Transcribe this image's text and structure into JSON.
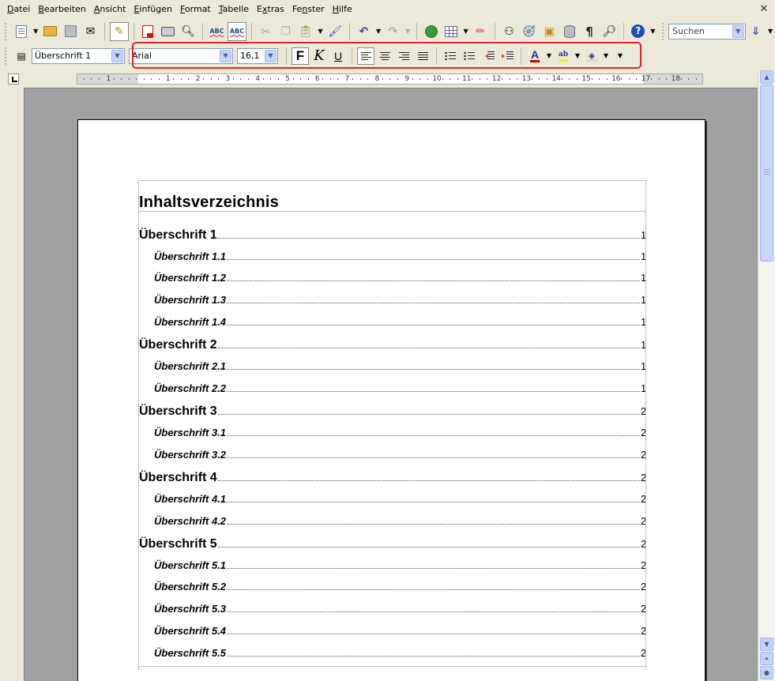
{
  "menu": [
    {
      "label": "Datei",
      "accel": "D"
    },
    {
      "label": "Bearbeiten",
      "accel": "B"
    },
    {
      "label": "Ansicht",
      "accel": "A"
    },
    {
      "label": "Einfügen",
      "accel": "E"
    },
    {
      "label": "Format",
      "accel": "F"
    },
    {
      "label": "Tabelle",
      "accel": "T"
    },
    {
      "label": "Extras",
      "accel": "x"
    },
    {
      "label": "Fenster",
      "accel": "n"
    },
    {
      "label": "Hilfe",
      "accel": "H"
    }
  ],
  "close_glyph": "✕",
  "toolbar": {
    "search_placeholder": "Suchen",
    "paragraph_style": "Überschrift 1",
    "font_name": "Arial",
    "font_size": "16,1",
    "bold_label": "F",
    "italic_label": "K",
    "underline_label": "U",
    "font_color_label": "A",
    "highlight_label": "ab"
  },
  "ruler": {
    "labels": [
      "1",
      "1",
      "2",
      "3",
      "4",
      "5",
      "6",
      "7",
      "8",
      "9",
      "10",
      "11",
      "12",
      "13",
      "14",
      "15",
      "16",
      "17",
      "18"
    ]
  },
  "document": {
    "toc_title": "Inhaltsverzeichnis",
    "entries": [
      {
        "text": "Überschrift 1",
        "page": "1",
        "level": 1
      },
      {
        "text": "Überschrift 1.1",
        "page": "1",
        "level": 2
      },
      {
        "text": "Überschrift 1.2",
        "page": "1",
        "level": 2
      },
      {
        "text": "Überschrift 1.3",
        "page": "1",
        "level": 2
      },
      {
        "text": "Überschrift 1.4",
        "page": "1",
        "level": 2
      },
      {
        "text": "Überschrift 2",
        "page": "1",
        "level": 1
      },
      {
        "text": "Überschrift 2.1",
        "page": "1",
        "level": 2
      },
      {
        "text": "Überschrift 2.2",
        "page": "1",
        "level": 2
      },
      {
        "text": "Überschrift 3",
        "page": "2",
        "level": 1
      },
      {
        "text": "Überschrift 3.1",
        "page": "2",
        "level": 2
      },
      {
        "text": "Überschrift 3.2",
        "page": "2",
        "level": 2
      },
      {
        "text": "Überschrift 4",
        "page": "2",
        "level": 1
      },
      {
        "text": "Überschrift 4.1",
        "page": "2",
        "level": 2
      },
      {
        "text": "Überschrift 4.2",
        "page": "2",
        "level": 2
      },
      {
        "text": "Überschrift 5",
        "page": "2",
        "level": 1
      },
      {
        "text": "Überschrift 5.1",
        "page": "2",
        "level": 2
      },
      {
        "text": "Überschrift 5.2",
        "page": "2",
        "level": 2
      },
      {
        "text": "Überschrift 5.3",
        "page": "2",
        "level": 2
      },
      {
        "text": "Überschrift 5.4",
        "page": "2",
        "level": 2
      },
      {
        "text": "Überschrift 5.5",
        "page": "2",
        "level": 2
      }
    ]
  },
  "colors": {
    "highlight_box": "#e0202a",
    "font_color_bar": "#cc0000",
    "highlight_bar": "#f3ef19"
  }
}
